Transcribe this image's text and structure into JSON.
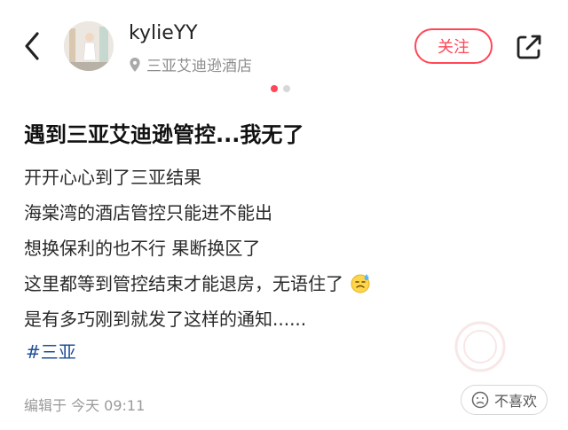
{
  "header": {
    "back_icon": "chevron-left-icon",
    "username": "kylieYY",
    "location": "三亚艾迪逊酒店",
    "follow_label": "关注",
    "share_icon": "share-icon",
    "accent": "#ff4757"
  },
  "carousel": {
    "count": 2,
    "active_index": 0
  },
  "post": {
    "title": "遇到三亚艾迪逊管控...我无了",
    "lines": [
      "开开心心到了三亚结果",
      "海棠湾的酒店管控只能进不能出",
      "想换保利的也不行 果断换区了",
      "这里都等到管控结束才能退房，无语住了",
      "是有多巧刚到就发了这样的通知......"
    ],
    "emoji_icon": "sweat-face-icon",
    "tag": "#三亚",
    "edited": "编辑于 今天 09:11"
  },
  "footer": {
    "dislike_label": "不喜欢"
  }
}
